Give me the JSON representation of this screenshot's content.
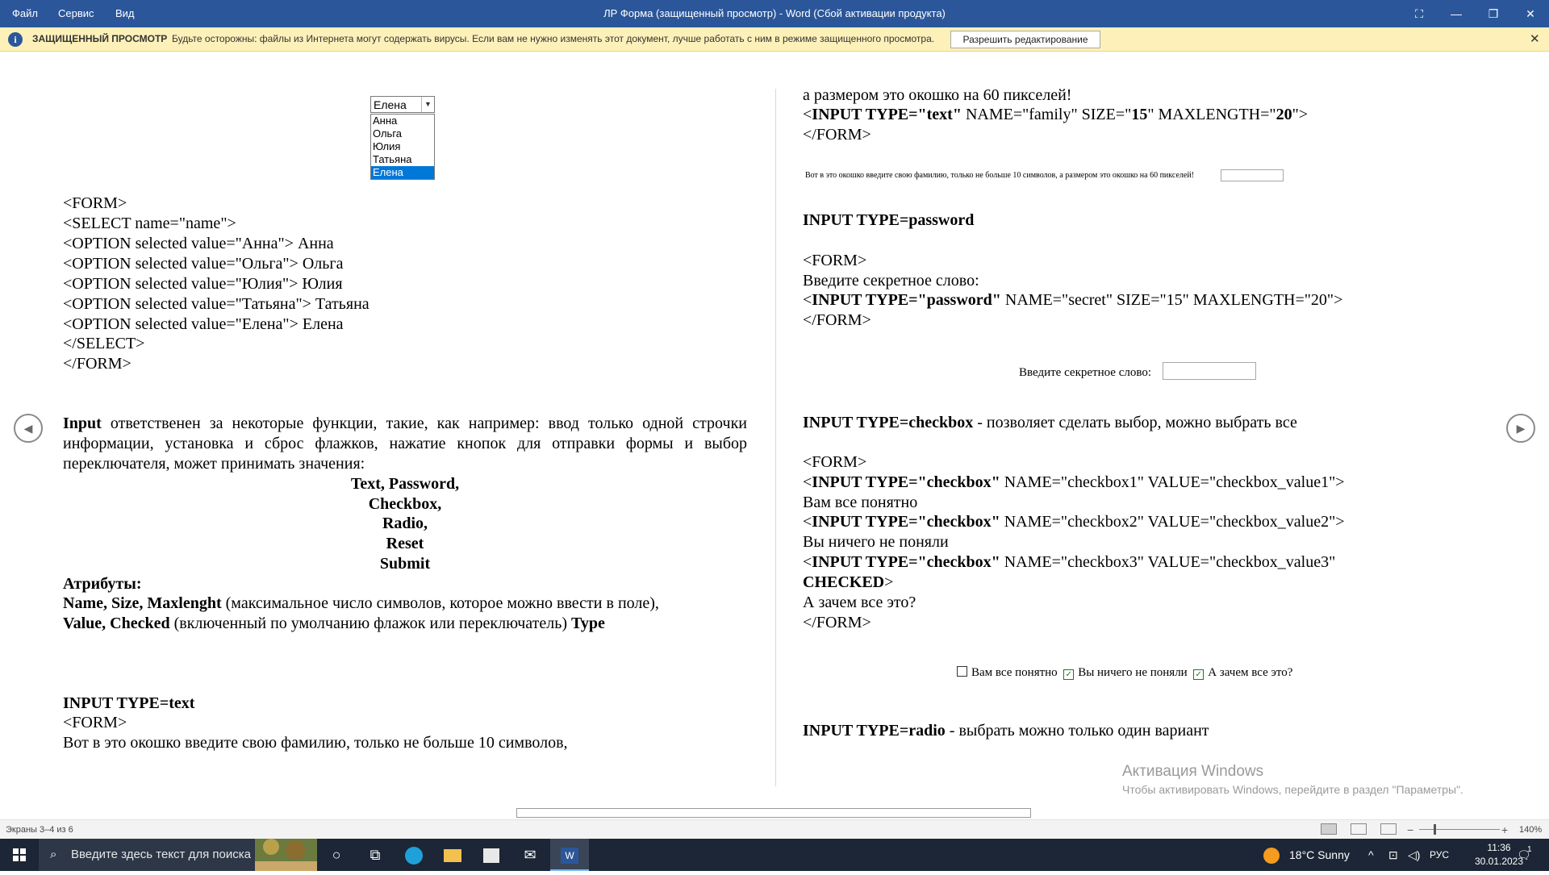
{
  "titlebar": {
    "menu": [
      "Файл",
      "Сервис",
      "Вид"
    ],
    "title": "ЛР Форма (защищенный просмотр) - Word (Сбой активации продукта)",
    "icons": [
      "fullscreen-icon",
      "minimize-icon",
      "restore-icon",
      "close-icon"
    ]
  },
  "protected_bar": {
    "title": "ЗАЩИЩЕННЫЙ ПРОСМОТР",
    "message": "Будьте осторожны: файлы из Интернета могут содержать вирусы. Если вам не нужно изменять этот документ, лучше работать с ним в режиме защищенного просмотра.",
    "button": "Разрешить редактирование",
    "close": "✕"
  },
  "left_page": {
    "select_value": "Елена",
    "select_options": [
      "Анна",
      "Ольга",
      "Юлия",
      "Татьяна",
      "Елена"
    ],
    "code_lines": [
      "<FORM>",
      "<SELECT name=\"name\">",
      "<OPTION selected value=\"Анна\"> Анна",
      "<OPTION selected value=\"Ольга\"> Ольга",
      "<OPTION selected value=\"Юлия\"> Юлия",
      "<OPTION selected value=\"Татьяна\"> Татьяна",
      "<OPTION selected value=\"Елена\"> Елена",
      "</SELECT>",
      "</FORM>"
    ],
    "input_word": "Input",
    "input_para": "ответственен за некоторые функции, такие, как например: ввод только одной строчки информации, установка и сброс флажков, нажатие кнопок для отправки формы и выбор переключателя, может принимать значения:",
    "types": [
      "Text, Password,",
      "Checkbox,",
      "Radio,",
      "Reset",
      "Submit"
    ],
    "attrs_heading": "Атрибуты:",
    "attrs_line1_bold": "Name, Size, Maxlenght",
    "attrs_line1_rest": "(максимальное число символов, которое можно ввести в поле),",
    "attrs_line2_bold": "Value, Checked",
    "attrs_line2_rest": "(включенный по умолчанию флажок или переключатель)",
    "attrs_line2_end": "Type",
    "text_heading": "INPUT TYPE=text",
    "text_form": "<FORM>",
    "text_line": "Вот в это окошко введите свою фамилию, только не больше 10 символов,"
  },
  "right_page": {
    "line1": "а размером это окошко на 60 пикселей!",
    "line2_pre": "<",
    "line2_bold": "INPUT TYPE=\"text\"",
    "line2_rest": " NAME=\"family\" SIZE=\"",
    "line2_b2": "15",
    "line2_mid": "\" MAXLENGTH=\"",
    "line2_b3": "20",
    "line2_end": "\">",
    "line3": "</FORM>",
    "sample_text": "Вот в это окошко введите свою фамилию, только не больше 10 символов, а размером это окошко на 60 пикселей!",
    "pw_heading": "INPUT TYPE=password",
    "pw_form": "<FORM>",
    "pw_prompt": "Введите секретное слово:",
    "pw_pre": "<",
    "pw_bold": "INPUT TYPE=\"password\"",
    "pw_rest": " NAME=\"secret\" SIZE=\"15\" MAXLENGTH=\"20\">",
    "pw_end": "</FORM>",
    "pw_sample": "Введите секретное слово:",
    "cb_heading_bold": "INPUT TYPE=checkbox",
    "cb_heading_rest": " - позволяет сделать выбор, можно выбрать все",
    "cb_form": "<FORM>",
    "cb1_pre": "<",
    "cb1_bold": "INPUT TYPE=\"checkbox\"",
    "cb1_rest": " NAME=\"checkbox1\" VALUE=\"checkbox_value1\">",
    "cb1_label": "Вам все понятно",
    "cb2_pre": "<",
    "cb2_bold": "INPUT TYPE=\"checkbox\"",
    "cb2_rest": " NAME=\"checkbox2\" VALUE=\"checkbox_value2\">",
    "cb2_label": "Вы ничего не поняли",
    "cb3_pre": "<",
    "cb3_bold": "INPUT TYPE=\"checkbox\"",
    "cb3_rest": " NAME=\"checkbox3\" VALUE=\"checkbox_value3\"",
    "cb3_bold2": "CHECKED",
    "cb3_end": ">",
    "cb3_label": "А зачем все это?",
    "cb_end": "</FORM>",
    "cb_samples": [
      {
        "label": "Вам все понятно",
        "checked": false
      },
      {
        "label": "Вы ничего не поняли",
        "checked": true
      },
      {
        "label": "А зачем все это?",
        "checked": true
      }
    ],
    "radio_bold": "INPUT TYPE=radio",
    "radio_rest": " - выбрать можно только один вариант"
  },
  "watermark": {
    "title": "Активация Windows",
    "subtitle": "Чтобы активировать Windows, перейдите в раздел \"Параметры\"."
  },
  "statusbar": {
    "pages": "Экраны 3–4 из 6",
    "zoom": "140%",
    "minus": "−",
    "plus": "+"
  },
  "taskbar": {
    "search_placeholder": "Введите здесь текст для поиска",
    "weather": "18°C  Sunny",
    "lang": "РУС",
    "time": "11:36",
    "date": "30.01.2023",
    "notifications": "1"
  }
}
